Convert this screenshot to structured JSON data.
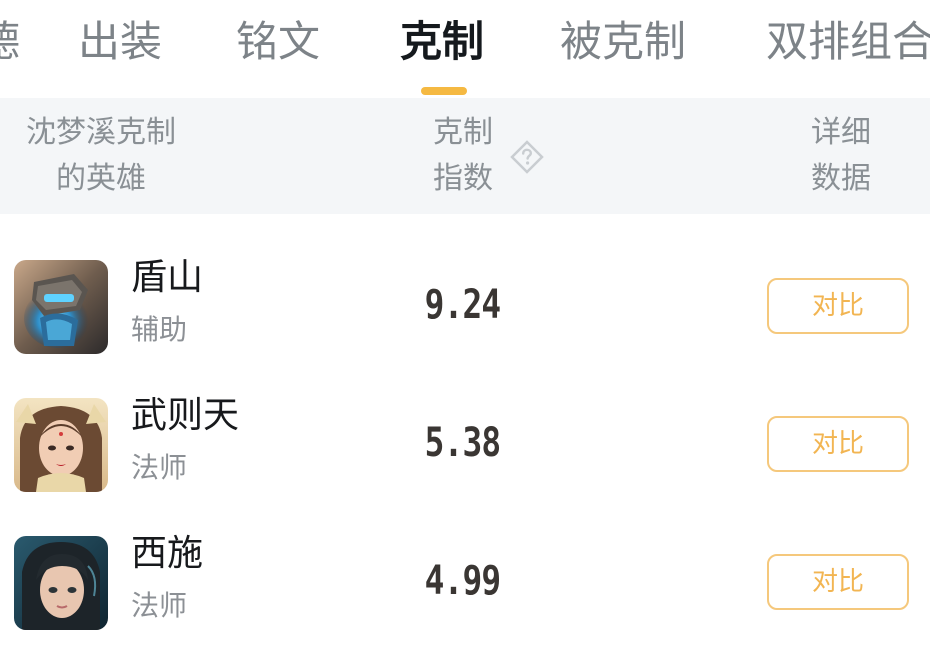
{
  "tabs": [
    {
      "label": "德",
      "active": false
    },
    {
      "label": "出装",
      "active": false
    },
    {
      "label": "铭文",
      "active": false
    },
    {
      "label": "克制",
      "active": true
    },
    {
      "label": "被克制",
      "active": false
    },
    {
      "label": "双排组合",
      "active": false
    }
  ],
  "accent_color": "#f5b942",
  "table_header": {
    "hero_col_line1": "沈梦溪克制",
    "hero_col_line2": "的英雄",
    "index_col_line1": "克制",
    "index_col_line2": "指数",
    "detail_col_line1": "详细",
    "detail_col_line2": "数据"
  },
  "rows": [
    {
      "name": "盾山",
      "role": "辅助",
      "score": "9.24",
      "button": "对比"
    },
    {
      "name": "武则天",
      "role": "法师",
      "score": "5.38",
      "button": "对比"
    },
    {
      "name": "西施",
      "role": "法师",
      "score": "4.99",
      "button": "对比"
    }
  ]
}
